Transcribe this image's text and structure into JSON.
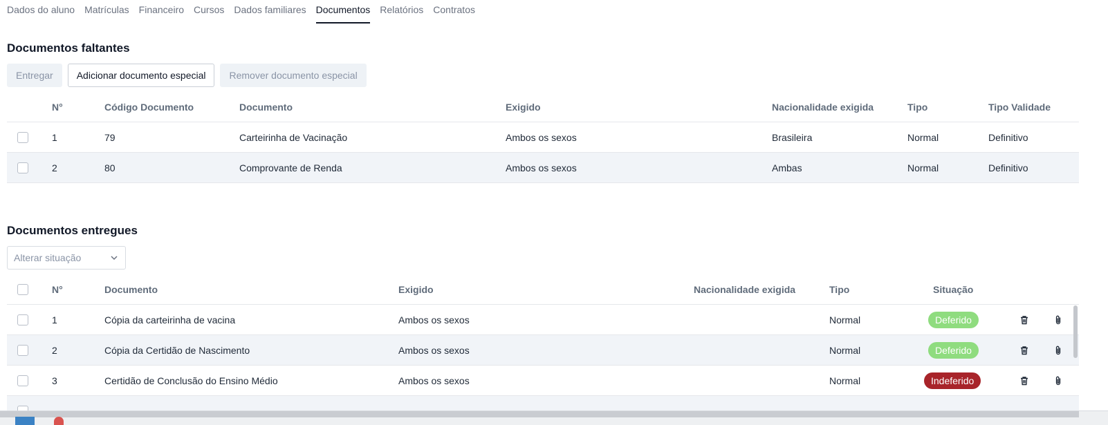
{
  "tabs": [
    {
      "label": "Dados do aluno",
      "active": false
    },
    {
      "label": "Matrículas",
      "active": false
    },
    {
      "label": "Financeiro",
      "active": false
    },
    {
      "label": "Cursos",
      "active": false
    },
    {
      "label": "Dados familiares",
      "active": false
    },
    {
      "label": "Documentos",
      "active": true
    },
    {
      "label": "Relatórios",
      "active": false
    },
    {
      "label": "Contratos",
      "active": false
    }
  ],
  "missing": {
    "title": "Documentos faltantes",
    "buttons": {
      "deliver": "Entregar",
      "add_special": "Adicionar documento especial",
      "remove_special": "Remover documento especial"
    },
    "headers": {
      "num": "N°",
      "code": "Código Documento",
      "document": "Documento",
      "required": "Exigido",
      "nationality": "Nacionalidade exigida",
      "type": "Tipo",
      "validity": "Tipo Validade"
    },
    "rows": [
      {
        "num": "1",
        "code": "79",
        "document": "Carteirinha de Vacinação",
        "required": "Ambos os sexos",
        "nationality": "Brasileira",
        "type": "Normal",
        "validity": "Definitivo"
      },
      {
        "num": "2",
        "code": "80",
        "document": "Comprovante de Renda",
        "required": "Ambos os sexos",
        "nationality": "Ambas",
        "type": "Normal",
        "validity": "Definitivo"
      }
    ]
  },
  "delivered": {
    "title": "Documentos entregues",
    "status_select": {
      "placeholder": "Alterar situação"
    },
    "headers": {
      "num": "N°",
      "document": "Documento",
      "required": "Exigido",
      "nationality": "Nacionalidade exigida",
      "type": "Tipo",
      "status": "Situação"
    },
    "rows": [
      {
        "num": "1",
        "document": "Cópia da carteirinha de vacina",
        "required": "Ambos os sexos",
        "nationality": "",
        "type": "Normal",
        "status": "Deferido"
      },
      {
        "num": "2",
        "document": "Cópia da Certidão de Nascimento",
        "required": "Ambos os sexos",
        "nationality": "",
        "type": "Normal",
        "status": "Deferido"
      },
      {
        "num": "3",
        "document": "Certidão de Conclusão do Ensino Médio",
        "required": "Ambos os sexos",
        "nationality": "",
        "type": "Normal",
        "status": "Indeferido"
      }
    ]
  },
  "colors": {
    "deferido": "#8fdc7f",
    "indeferido": "#a8242a",
    "active_tab": "#111827"
  },
  "icons": {
    "delete": "trash-icon",
    "attach": "paperclip-icon",
    "dropdown": "chevron-down-icon"
  }
}
